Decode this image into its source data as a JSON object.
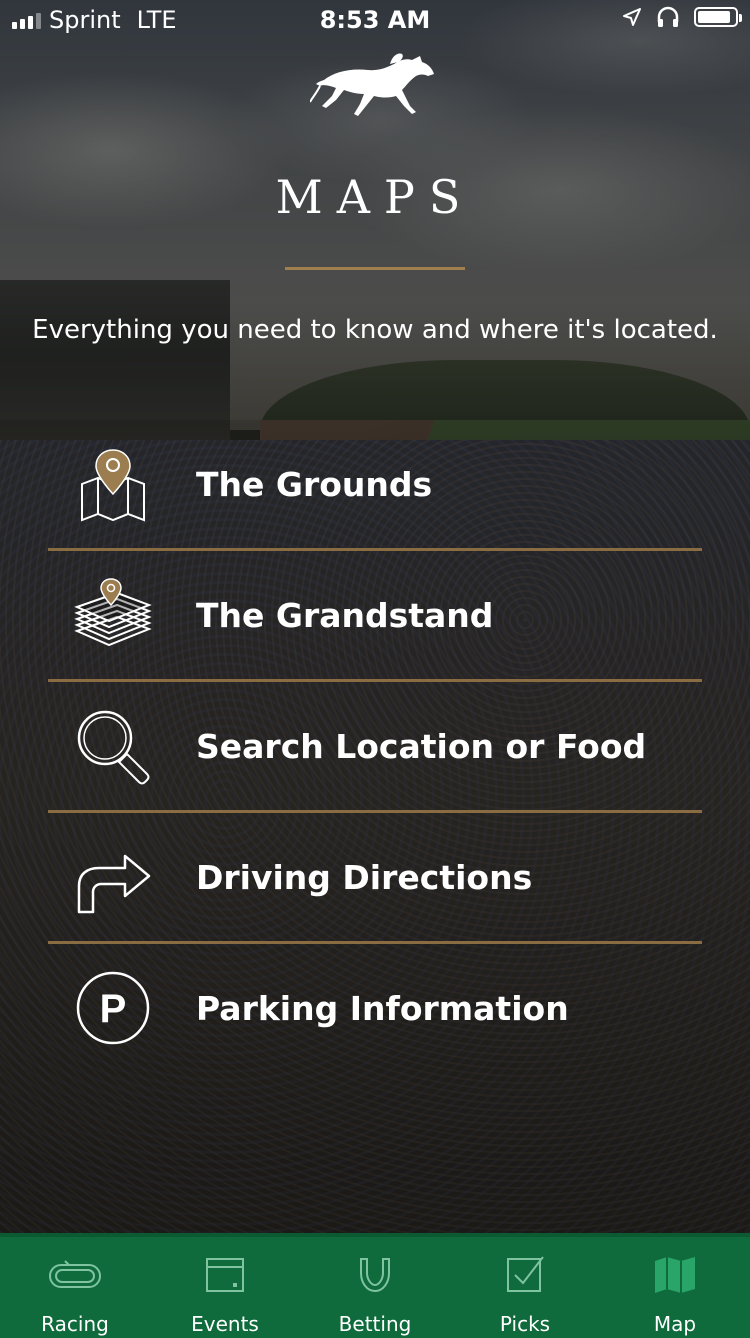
{
  "status_bar": {
    "carrier": "Sprint",
    "network": "LTE",
    "time": "8:53 AM",
    "battery_level": 0.9,
    "icons": [
      "signal-icon",
      "location-arrow-icon",
      "headphones-icon",
      "battery-icon"
    ]
  },
  "header": {
    "logo": "horse-and-jockey-logo",
    "title": "MAPS",
    "subtitle": "Everything you need to know and where it's located."
  },
  "colors": {
    "accent_gold": "#a07f4f",
    "tab_bar_green": "#0f6b3c",
    "active_tab_icon": "#2aa56a"
  },
  "menu": {
    "items": [
      {
        "label": "The Grounds",
        "icon": "folded-map-pin-icon"
      },
      {
        "label": "The Grandstand",
        "icon": "stacked-layers-pin-icon"
      },
      {
        "label": "Search Location or Food",
        "icon": "magnifier-icon"
      },
      {
        "label": "Driving Directions",
        "icon": "turn-right-arrow-icon"
      },
      {
        "label": "Parking Information",
        "icon": "parking-icon"
      }
    ]
  },
  "tabs": [
    {
      "label": "Racing",
      "icon": "racetrack-icon",
      "active": false
    },
    {
      "label": "Events",
      "icon": "calendar-icon",
      "active": false
    },
    {
      "label": "Betting",
      "icon": "horseshoe-icon",
      "active": false
    },
    {
      "label": "Picks",
      "icon": "checkbox-icon",
      "active": false
    },
    {
      "label": "Map",
      "icon": "map-icon",
      "active": true
    }
  ]
}
